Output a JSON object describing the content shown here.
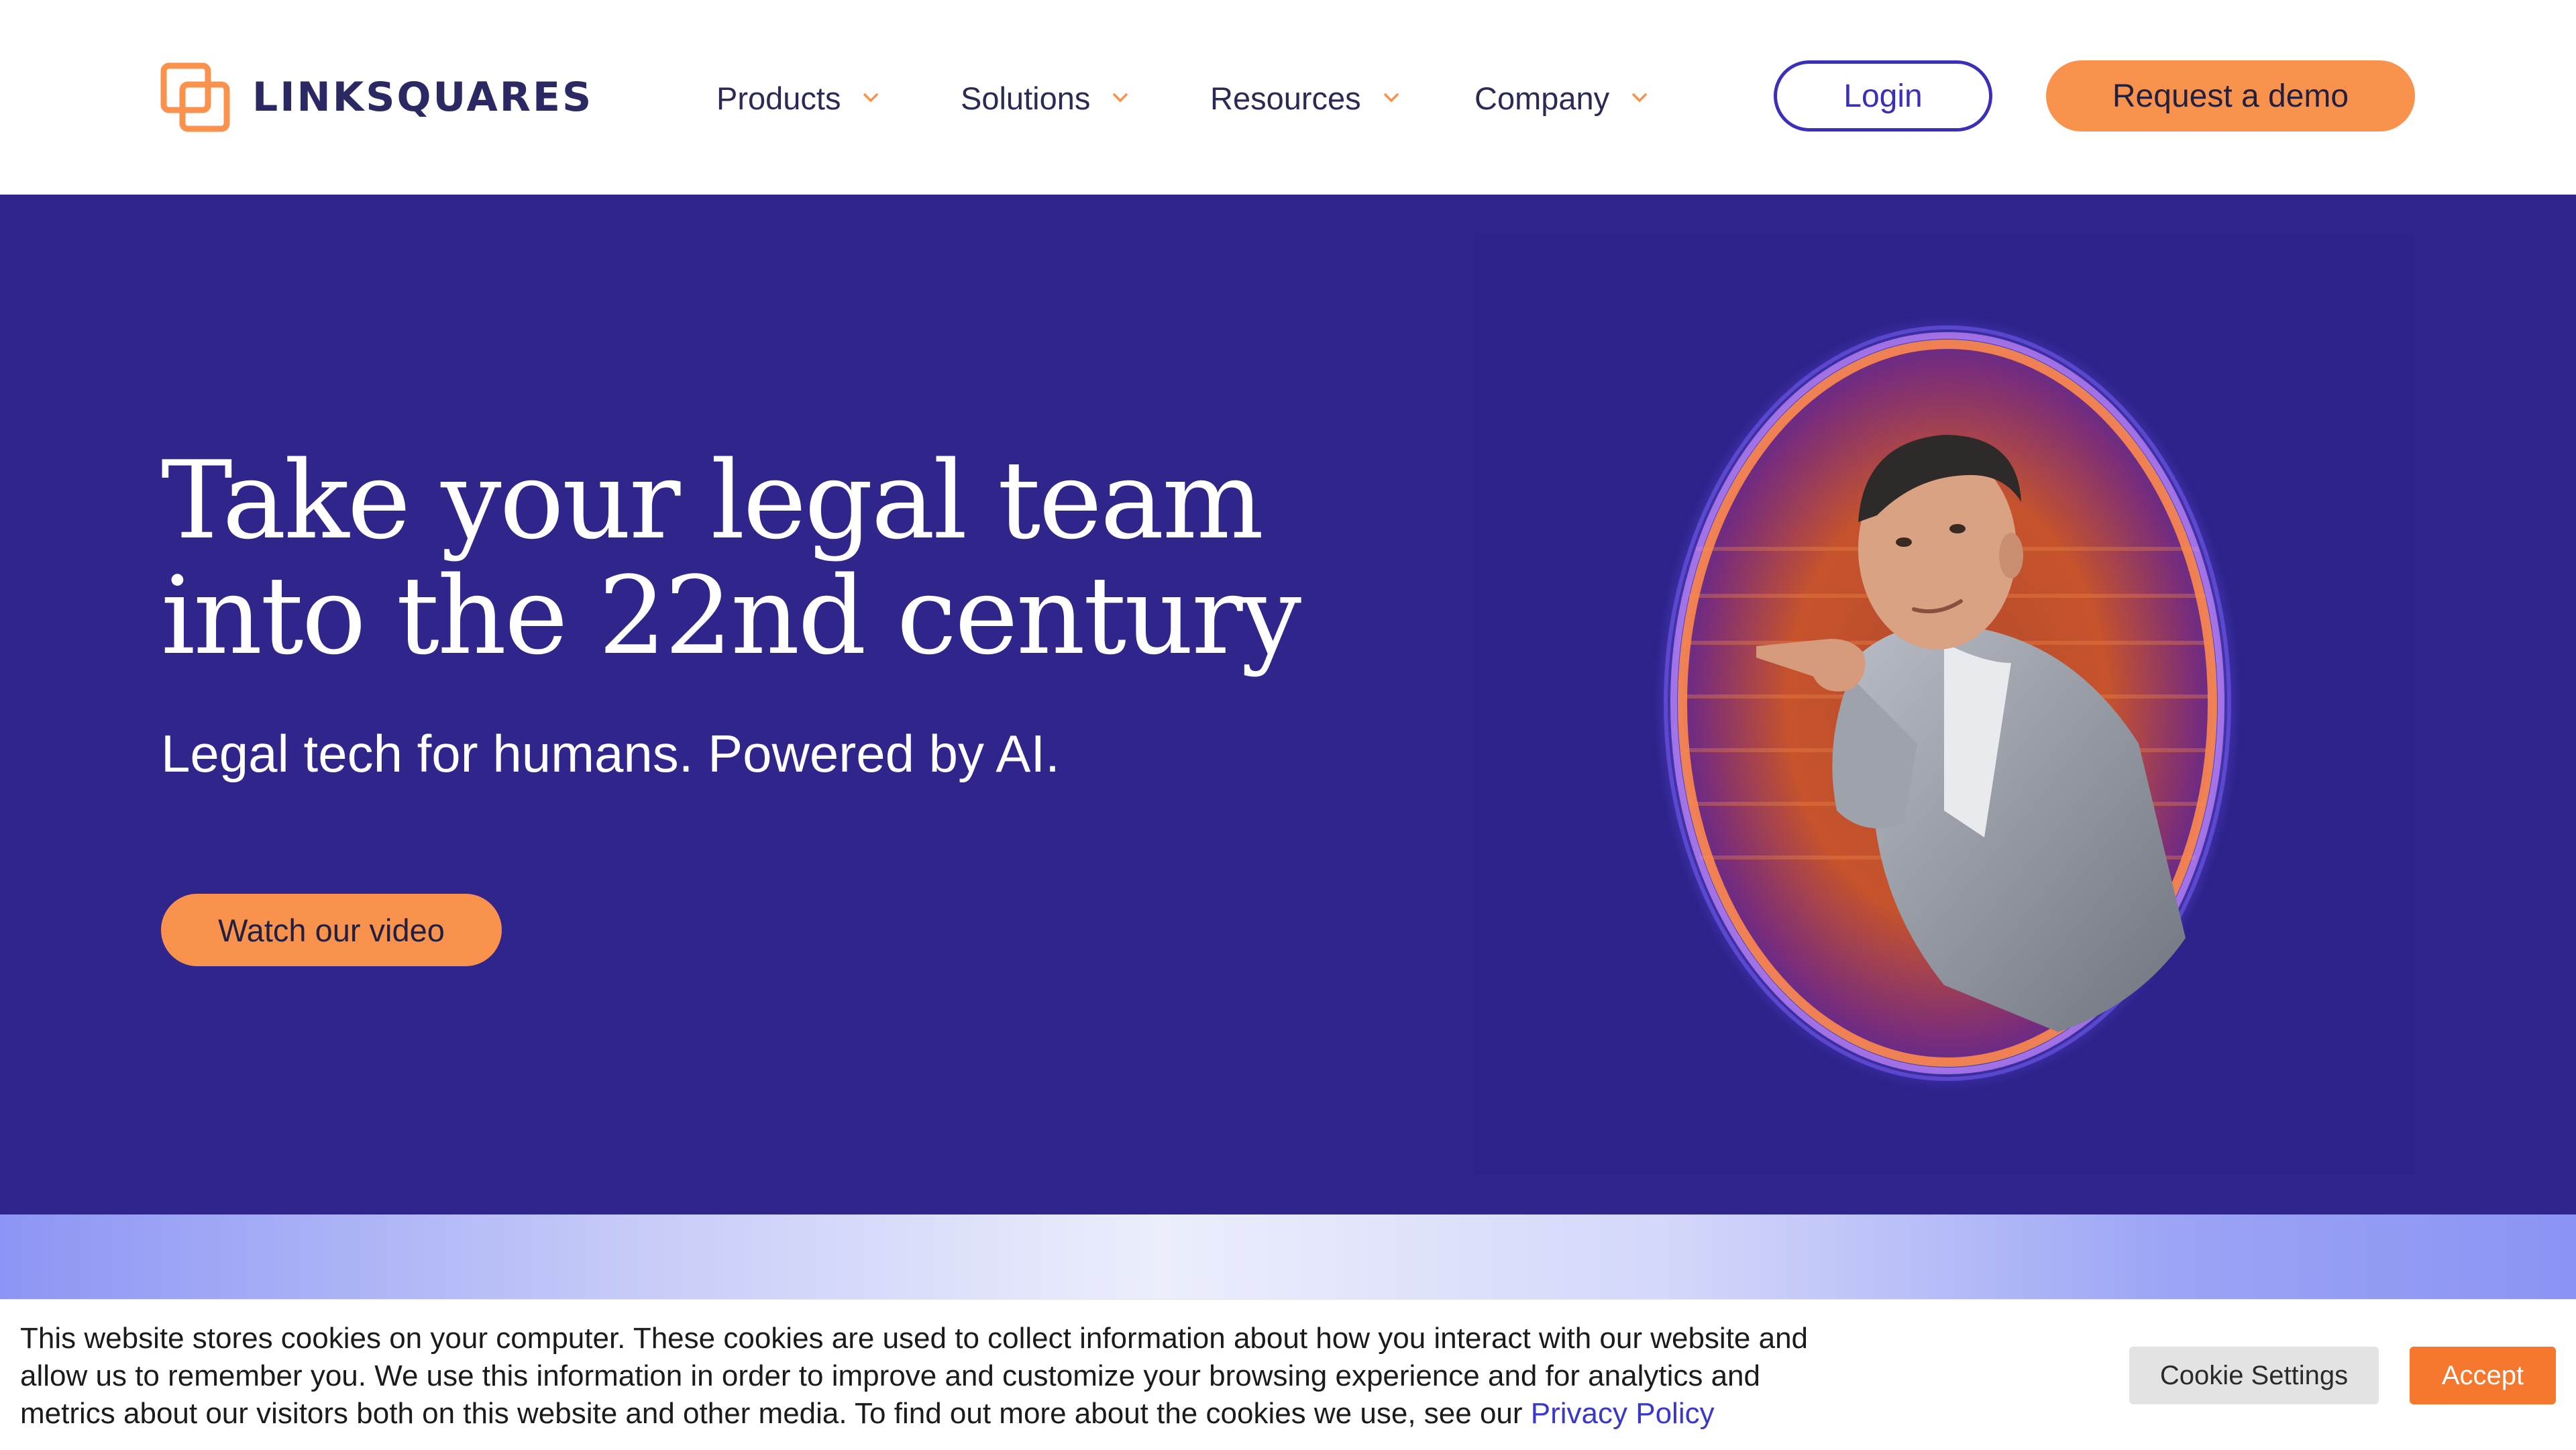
{
  "brand": {
    "name": "LINKSQUARES",
    "accent": "#f8924d",
    "navy": "#30258a"
  },
  "nav": {
    "items": [
      {
        "label": "Products",
        "icon": "chevron-down-icon"
      },
      {
        "label": "Solutions",
        "icon": "chevron-down-icon"
      },
      {
        "label": "Resources",
        "icon": "chevron-down-icon"
      },
      {
        "label": "Company",
        "icon": "chevron-down-icon"
      }
    ],
    "login_label": "Login",
    "demo_label": "Request a demo"
  },
  "hero": {
    "headline_line1": "Take your legal team",
    "headline_line2": "into the 22nd century",
    "subhead": "Legal tech for humans. Powered by AI.",
    "cta_label": "Watch our video"
  },
  "cookie": {
    "text": "This website stores cookies on your computer. These cookies are used to collect information about how you interact with our website and allow us to remember you. We use this information in order to improve and customize your browsing experience and for analytics and metrics about our visitors both on this website and other media. To find out more about the cookies we use, see our",
    "link_label": "Privacy Policy",
    "settings_label": "Cookie Settings",
    "accept_label": "Accept"
  }
}
